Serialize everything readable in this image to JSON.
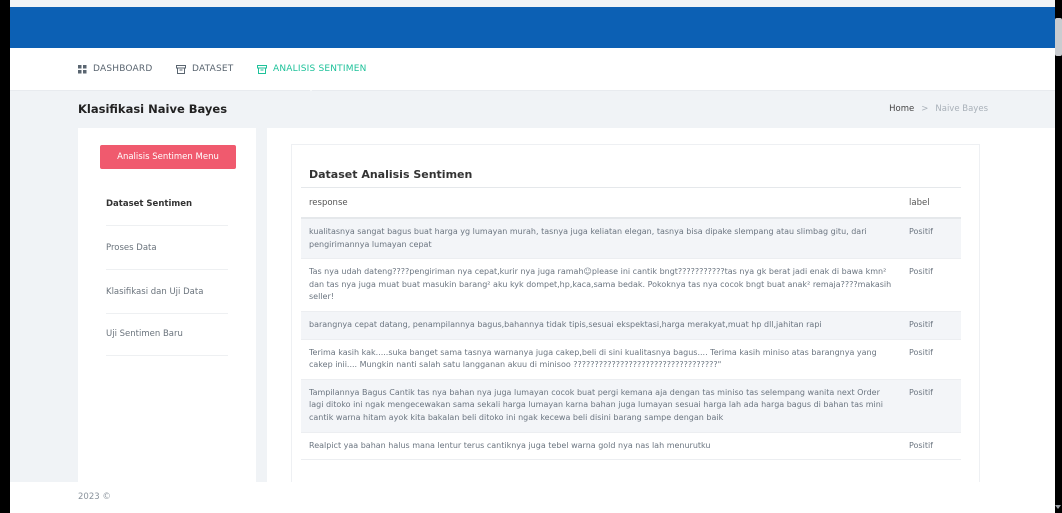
{
  "nav": {
    "items": [
      {
        "label": "DASHBOARD",
        "icon": "grid-icon"
      },
      {
        "label": "DATASET",
        "icon": "archive-icon"
      },
      {
        "label": "ANALISIS SENTIMEN",
        "icon": "archive-icon",
        "active": true
      }
    ]
  },
  "page": {
    "title": "Klasifikasi Naive Bayes",
    "breadcrumb": {
      "home": "Home",
      "separator": ">",
      "current": "Naive Bayes"
    }
  },
  "sidebar": {
    "menu_button": "Analisis Sentimen Menu",
    "items": [
      {
        "label": "Dataset Sentimen",
        "active": true
      },
      {
        "label": "Proses Data"
      },
      {
        "label": "Klasifikasi dan Uji Data"
      },
      {
        "label": "Uji Sentimen Baru"
      }
    ]
  },
  "card": {
    "title": "Dataset Analisis Sentimen",
    "columns": [
      "response",
      "label"
    ],
    "rows": [
      {
        "response": "kualitasnya sangat bagus buat harga yg lumayan murah, tasnya juga keliatan elegan, tasnya bisa dipake slempang atau slimbag gitu, dari pengirimannya lumayan cepat",
        "label": "Positif"
      },
      {
        "response": "Tas nya udah dateng????pengiriman nya cepat,kurir nya juga ramah☺please ini cantik bngt???????????tas nya gk berat jadi enak di bawa kmn² dan tas nya juga muat buat masukin barang² aku kyk dompet,hp,kaca,sama bedak. Pokoknya tas nya cocok bngt buat anak² remaja????makasih seller!",
        "label": "Positif"
      },
      {
        "response": "barangnya cepat datang, penampilannya bagus,bahannya tidak tipis,sesuai ekspektasi,harga merakyat,muat hp dll,jahitan rapi",
        "label": "Positif"
      },
      {
        "response": "Terima kasih kak.....suka banget sama tasnya warnanya juga cakep,beli di sini kualitasnya bagus.... Terima kasih miniso atas barangnya yang cakep inii.... Mungkin nanti salah satu langganan akuu di minisoo ??????????????????????????????????\"",
        "label": "Positif"
      },
      {
        "response": "Tampilannya Bagus Cantik tas nya bahan nya juga lumayan cocok buat pergi kemana aja dengan tas miniso tas selempang wanita next Order lagi ditoko ini ngak mengecewakan sama sekali harga lumayan karna bahan juga lumayan sesuai harga lah ada harga bagus di bahan tas mini cantik warna hitam ayok kita bakalan beli ditoko ini ngak kecewa beli disini barang sampe dengan baik",
        "label": "Positif"
      },
      {
        "response": "Realpict yaa bahan halus mana lentur terus cantiknya juga tebel warna gold nya nas lah menurutku",
        "label": "Positif"
      }
    ]
  },
  "footer": {
    "text": "2023 ©"
  },
  "colors": {
    "topbar": "#0c60b4",
    "accent": "#1ec29a",
    "menu_button": "#f05a6e"
  }
}
